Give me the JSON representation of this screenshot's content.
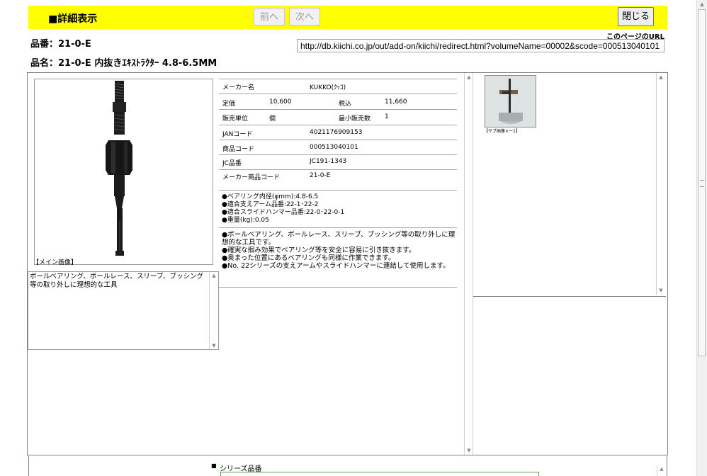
{
  "header": {
    "title": "■詳細表示",
    "prev_label": "前へ",
    "next_label": "次へ",
    "close_label": "閉じる",
    "bar_color": "#ffff00"
  },
  "product": {
    "number_line": "品番：21-0-E",
    "name_line": "品名：21-0-E 内抜きｴｷｽﾄﾗｸﾀｰ 4.8-6.5MM"
  },
  "page_url": {
    "caption": "このページのURL",
    "value": "http://db.kiichi.co.jp/out/add-on/kiichi/redirect.html?volumeName=00002&scode=000513040101"
  },
  "main_image": {
    "caption": "【メイン画像】"
  },
  "short_description": "ボールベアリング、ボールレース、スリーブ、ブッシング等の取り外しに理想的な工具",
  "specs": {
    "maker_label": "メーカー名",
    "maker_value": "KUKKO(ｸｯｺ)",
    "price_label": "定価",
    "price_value": "10,600",
    "tax_label": "税込",
    "tax_value": "11,660",
    "unit_label": "販売単位",
    "unit_value": "個",
    "min_label": "最小販売数",
    "min_value": "1",
    "jan_label": "JANコード",
    "jan_value": "4021176909153",
    "code_label": "商品コード",
    "code_value": "000513040101",
    "jc_label": "JC品番",
    "jc_value": "JC191-1343",
    "maker_code_label": "メーカー商品コード",
    "maker_code_value": "21-0-E"
  },
  "bullets": [
    "●ベアリング内径(φmm):4.8-6.5",
    "●適合支えアーム品番:22-1･22-2",
    "●適合スライドハンマー品番:22-0･22-0-1",
    "●重量(kg):0.05"
  ],
  "features": [
    "●ボールベアリング、ボールレース、スリーブ、ブッシング等の取り外しに理想的な工具です。",
    "●確実な掴み効果でベアリング等を安全に容易に引き抜きます。",
    "●奥まった位置にあるベアリングも同様に作業できます。",
    "●No. 22シリーズの支えアームやスライドハンマーに連結して使用します。"
  ],
  "sub_image": {
    "caption": "【サブ画像×ー1】"
  },
  "series": {
    "caption": "シリーズ品番"
  }
}
